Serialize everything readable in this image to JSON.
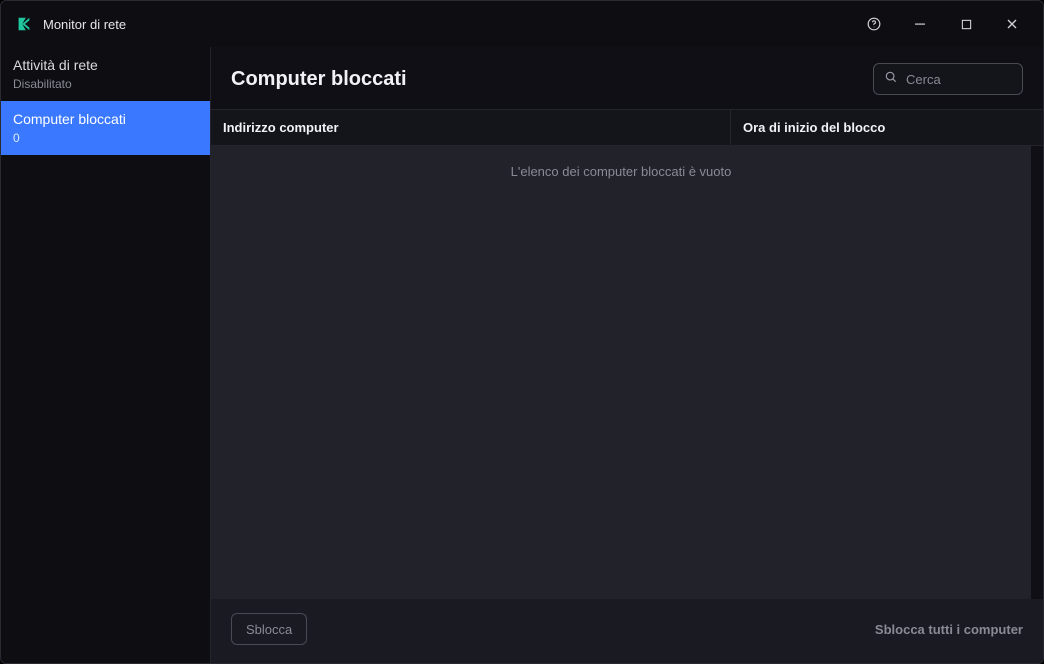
{
  "window": {
    "title": "Monitor di rete"
  },
  "sidebar": {
    "items": [
      {
        "label": "Attività di rete",
        "sub": "Disabilitato",
        "active": false
      },
      {
        "label": "Computer bloccati",
        "sub": "0",
        "active": true
      }
    ]
  },
  "main": {
    "title": "Computer bloccati",
    "search": {
      "placeholder": "Cerca",
      "value": ""
    },
    "columns": [
      "Indirizzo computer",
      "Ora di inizio del blocco"
    ],
    "empty_message": "L'elenco dei computer bloccati è vuoto",
    "rows": []
  },
  "footer": {
    "unblock": "Sblocca",
    "unblock_all": "Sblocca tutti i computer"
  }
}
